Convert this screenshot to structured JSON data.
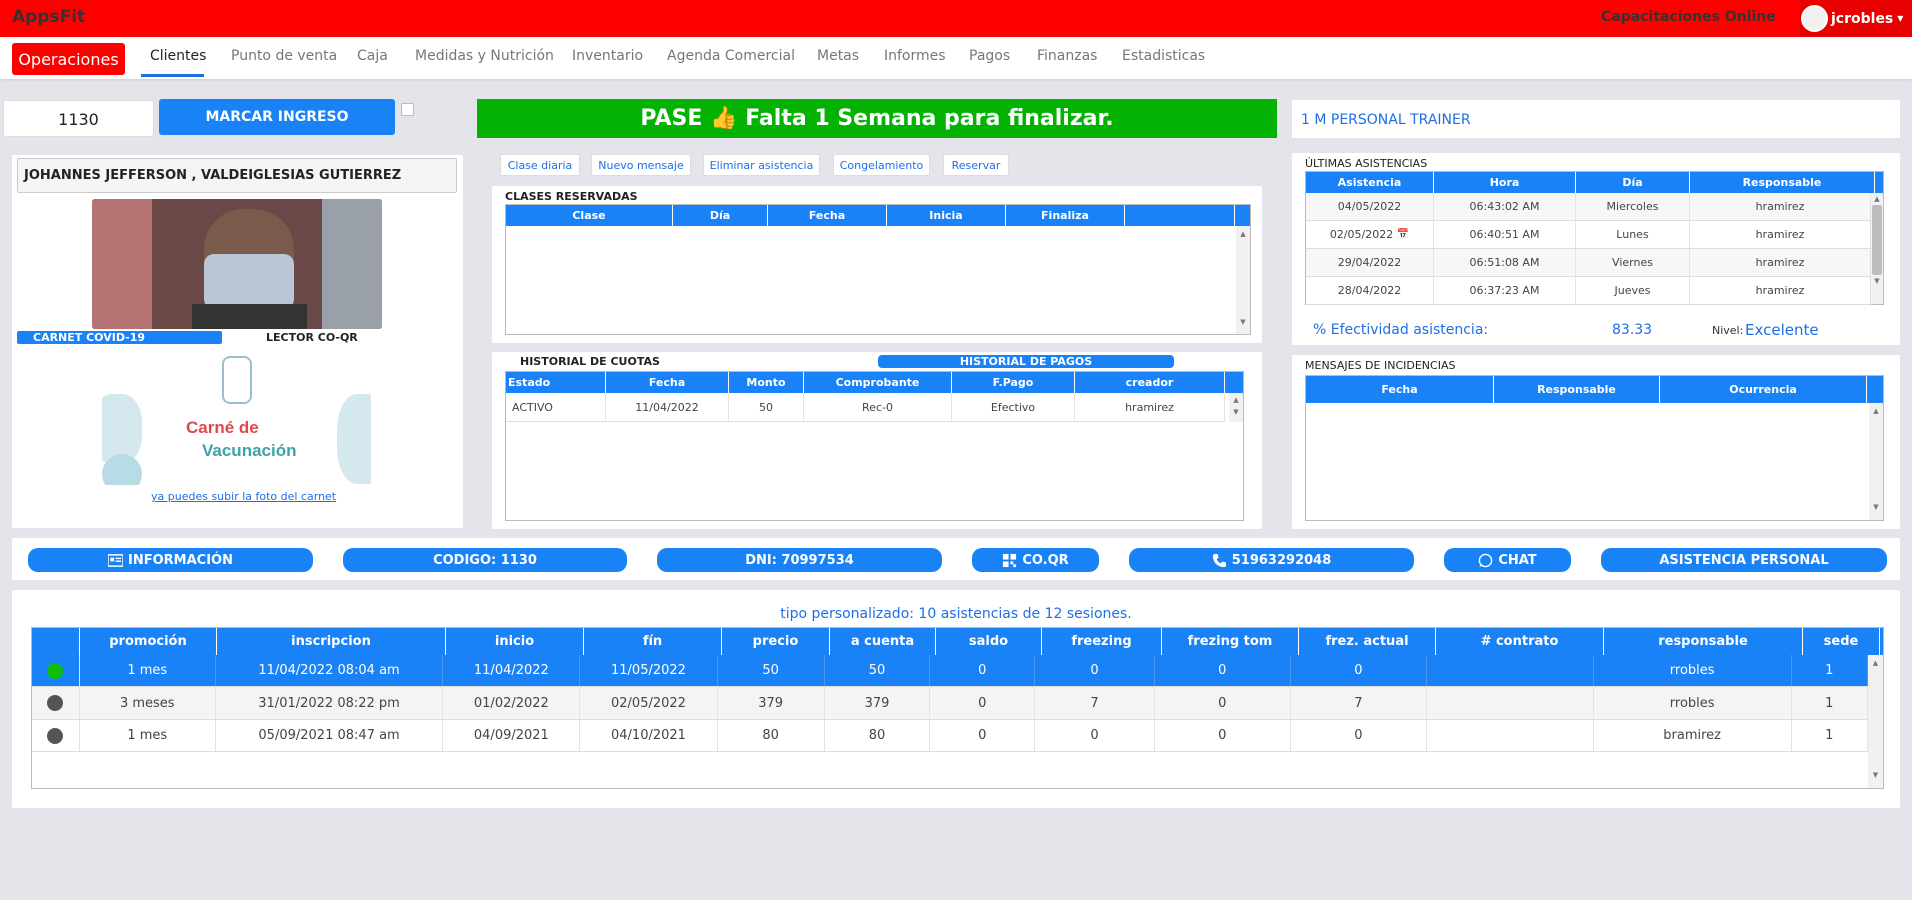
{
  "app": {
    "brand": "AppsFit",
    "capacitaciones": "Capacitaciones Online",
    "user": "jcrobles"
  },
  "nav": {
    "operaciones": "Operaciones",
    "tabs": [
      "Clientes",
      "Punto de venta",
      "Caja",
      "Medidas y Nutrición",
      "Inventario",
      "Agenda Comercial",
      "Metas",
      "Informes",
      "Pagos",
      "Finanzas",
      "Estadisticas"
    ],
    "active": "Clientes"
  },
  "ingreso": {
    "id_value": "1130",
    "marcar": "MARCAR INGRESO"
  },
  "pase": {
    "label": "PASE",
    "emoji": "👍",
    "message": "Falta 1 Semana para finalizar."
  },
  "plan": "1 M PERSONAL TRAINER",
  "client": {
    "name": "JOHANNES JEFFERSON , VALDEIGLESIAS GUTIERREZ",
    "carnet_covid": "CARNET COVID-19",
    "lector": "LECTOR CO-QR",
    "carnet_text_1": "Carné de",
    "carnet_text_2": "Vacunación",
    "upload_link": "ya puedes subir la foto del carnet"
  },
  "actions": [
    "Clase diaria",
    "Nuevo mensaje",
    "Eliminar asistencia",
    "Congelamiento",
    "Reservar"
  ],
  "clases": {
    "title": "CLASES RESERVADAS",
    "columns": [
      "Clase",
      "Día",
      "Fecha",
      "Inicia",
      "Finaliza",
      ""
    ]
  },
  "cuotas": {
    "tab1": "HISTORIAL DE CUOTAS",
    "tab2": "HISTORIAL DE PAGOS",
    "columns": [
      "Estado",
      "Fecha",
      "Monto",
      "Comprobante",
      "F.Pago",
      "creador"
    ],
    "rows": [
      [
        "ACTIVO",
        "11/04/2022",
        "50",
        "Rec-0",
        "Efectivo",
        "hramirez"
      ]
    ]
  },
  "asistencias": {
    "title": "ÚLTIMAS ASISTENCIAS",
    "columns": [
      "Asistencia",
      "Hora",
      "Día",
      "Responsable"
    ],
    "rows": [
      [
        "04/05/2022",
        "06:43:02 AM",
        "Miercoles",
        "hramirez"
      ],
      [
        "02/05/2022",
        "06:40:51 AM",
        "Lunes",
        "hramirez"
      ],
      [
        "29/04/2022",
        "06:51:08 AM",
        "Viernes",
        "hramirez"
      ],
      [
        "28/04/2022",
        "06:37:23 AM",
        "Jueves",
        "hramirez"
      ]
    ],
    "efectividad_label": "% Efectividad asistencia:",
    "efectividad_value": "83.33",
    "nivel_label": "Nivel:",
    "nivel_value": "Excelente"
  },
  "incidencias": {
    "title": "MENSAJES DE INCIDENCIAS",
    "columns": [
      "Fecha",
      "Responsable",
      "Ocurrencia"
    ]
  },
  "pills": {
    "informacion": "INFORMACIÓN",
    "codigo": "CODIGO: 1130",
    "dni": "DNI: 70997534",
    "coqr": "CO.QR",
    "telefono": "51963292048",
    "chat": "CHAT",
    "asistencia_personal": "ASISTENCIA PERSONAL"
  },
  "membresias": {
    "summary": "tipo personalizado: 10 asistencias de 12 sesiones.",
    "columns": [
      "",
      "promoción",
      "inscripcion",
      "inicio",
      "fín",
      "precio",
      "a cuenta",
      "saldo",
      "freezing",
      "frezing tom",
      "frez. actual",
      "# contrato",
      "responsable",
      "sede"
    ],
    "rows": [
      {
        "status": "active",
        "status_color": "#0bbf0b",
        "cells": [
          "1 mes",
          "11/04/2022 08:04 am",
          "11/04/2022",
          "11/05/2022",
          "50",
          "50",
          "0",
          "0",
          "0",
          "0",
          "",
          "rrobles",
          "1"
        ]
      },
      {
        "status": "inactive",
        "status_color": "#555555",
        "cells": [
          "3 meses",
          "31/01/2022 08:22 pm",
          "01/02/2022",
          "02/05/2022",
          "379",
          "379",
          "0",
          "7",
          "0",
          "7",
          "",
          "rrobles",
          "1"
        ]
      },
      {
        "status": "inactive",
        "status_color": "#555555",
        "cells": [
          "1 mes",
          "05/09/2021 08:47 am",
          "04/09/2021",
          "04/10/2021",
          "80",
          "80",
          "0",
          "0",
          "0",
          "0",
          "",
          "bramirez",
          "1"
        ]
      }
    ]
  },
  "colors": {
    "brand_red": "#ff0000",
    "primary_blue": "#1a82f7",
    "pase_green": "#04b204"
  }
}
